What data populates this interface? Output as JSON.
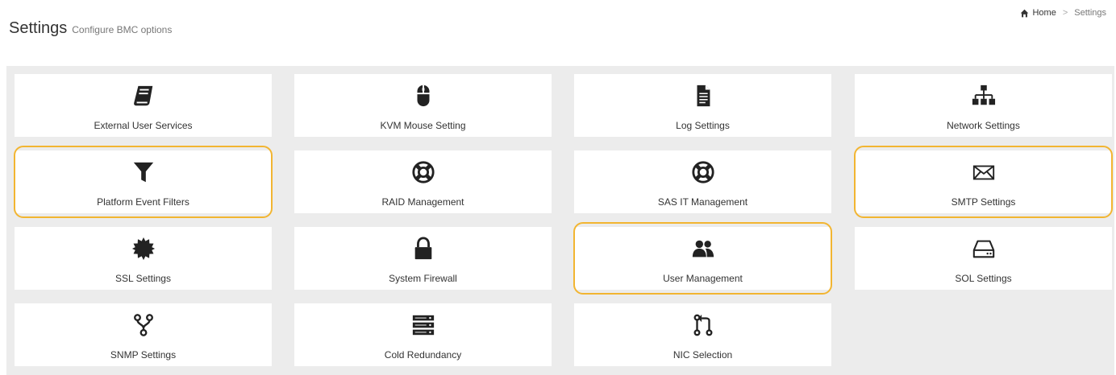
{
  "header": {
    "title": "Settings",
    "subtitle": "Configure BMC options"
  },
  "breadcrumb": {
    "home": "Home",
    "separator": ">",
    "current": "Settings"
  },
  "cards": [
    {
      "label": "External User Services",
      "icon": "book-icon"
    },
    {
      "label": "KVM Mouse Setting",
      "icon": "mouse-icon"
    },
    {
      "label": "Log Settings",
      "icon": "file-text-icon"
    },
    {
      "label": "Network Settings",
      "icon": "sitemap-icon"
    },
    {
      "label": "Platform Event Filters",
      "icon": "filter-icon"
    },
    {
      "label": "RAID Management",
      "icon": "life-ring-icon"
    },
    {
      "label": "SAS IT Management",
      "icon": "life-ring-icon"
    },
    {
      "label": "SMTP Settings",
      "icon": "envelope-icon"
    },
    {
      "label": "SSL Settings",
      "icon": "certificate-icon"
    },
    {
      "label": "System Firewall",
      "icon": "lock-icon"
    },
    {
      "label": "User Management",
      "icon": "users-icon"
    },
    {
      "label": "SOL Settings",
      "icon": "hdd-icon"
    },
    {
      "label": "SNMP Settings",
      "icon": "code-fork-icon"
    },
    {
      "label": "Cold Redundancy",
      "icon": "server-icon"
    },
    {
      "label": "NIC Selection",
      "icon": "git-pull-request-icon"
    }
  ],
  "highlighted": [
    "Platform Event Filters",
    "SMTP Settings",
    "User Management"
  ],
  "colors": {
    "highlight": "#f2b531",
    "icon": "#222222",
    "background": "#ececec",
    "card": "#ffffff"
  }
}
